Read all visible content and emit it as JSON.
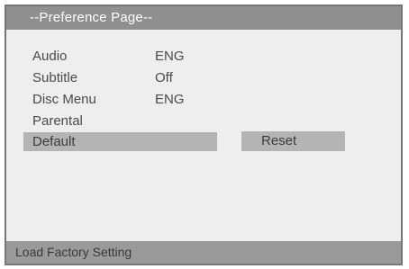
{
  "window": {
    "title": "--Preference Page--"
  },
  "menu": {
    "items": [
      {
        "label": "Audio",
        "value": "ENG"
      },
      {
        "label": "Subtitle",
        "value": "Off"
      },
      {
        "label": "Disc Menu",
        "value": "ENG"
      },
      {
        "label": "Parental",
        "value": ""
      },
      {
        "label": "Default",
        "value": ""
      }
    ],
    "selected_index": 4,
    "selected_option": "Reset"
  },
  "status": {
    "text": "Load Factory Setting"
  },
  "colors": {
    "title_bar": "#8f8f8f",
    "background": "#eeeeee",
    "highlight": "#b4b4b4",
    "status_bar": "#9a9a9a",
    "text": "#4a4a4a"
  }
}
